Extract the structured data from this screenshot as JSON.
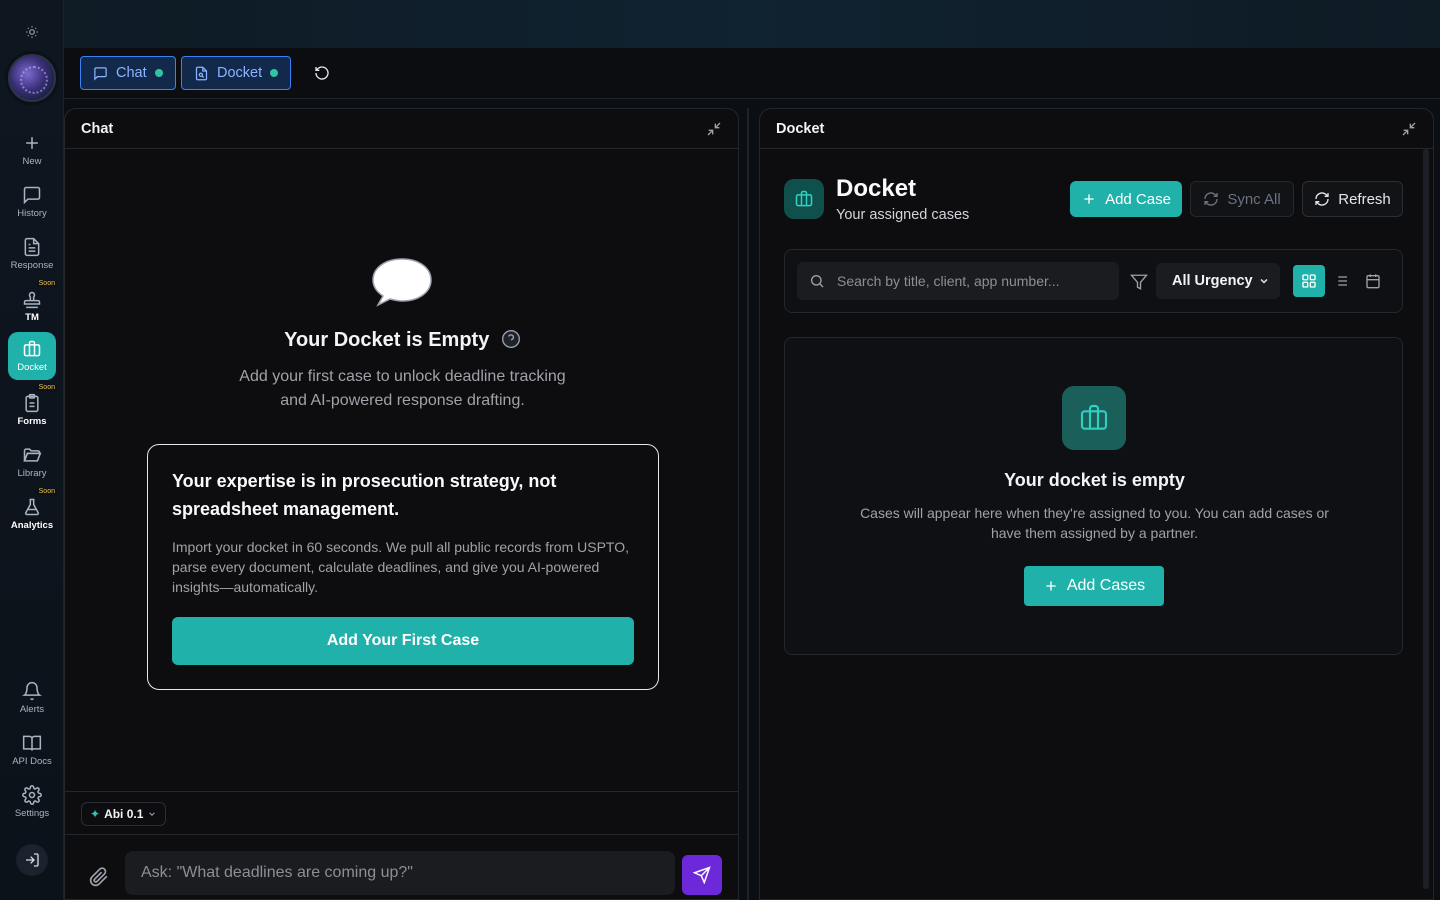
{
  "sidebar": {
    "items": [
      {
        "label": "New",
        "icon": "plus-icon"
      },
      {
        "label": "History",
        "icon": "message-square-icon"
      },
      {
        "label": "Response",
        "icon": "file-text-icon"
      },
      {
        "label": "TM",
        "icon": "stamp-icon",
        "badge": "Soon"
      },
      {
        "label": "Docket",
        "icon": "briefcase-icon"
      },
      {
        "label": "Forms",
        "icon": "clipboard-icon",
        "badge": "Soon"
      },
      {
        "label": "Library",
        "icon": "folder-open-icon"
      },
      {
        "label": "Analytics",
        "icon": "flask-icon",
        "badge": "Soon"
      },
      {
        "label": "Alerts",
        "icon": "bell-icon"
      },
      {
        "label": "API Docs",
        "icon": "book-open-icon"
      },
      {
        "label": "Settings",
        "icon": "gear-icon"
      }
    ],
    "active": "Docket"
  },
  "toolbar": {
    "tabs": [
      {
        "label": "Chat",
        "icon": "message-square-icon"
      },
      {
        "label": "Docket",
        "icon": "file-search-icon"
      }
    ]
  },
  "chat": {
    "header": "Chat",
    "empty_title": "Your Docket is Empty",
    "empty_sub_line1": "Add your first case to unlock deadline tracking",
    "empty_sub_line2": "and AI-powered response drafting.",
    "promo_title": "Your expertise is in prosecution strategy, not spreadsheet management.",
    "promo_body": "Import your docket in 60 seconds. We pull all public records from USPTO, parse every document, calculate deadlines, and give you AI-powered insights—automatically.",
    "promo_button": "Add Your First Case",
    "model": "Abi 0.1",
    "input_placeholder": "Ask: \"What deadlines are coming up?\""
  },
  "docket": {
    "header": "Docket",
    "title": "Docket",
    "subtitle": "Your assigned cases",
    "add_case": "Add Case",
    "sync_all": "Sync All",
    "refresh": "Refresh",
    "search_placeholder": "Search by title, client, app number...",
    "urgency_selected": "All Urgency",
    "view_mode": "grid",
    "empty_title": "Your docket is empty",
    "empty_sub": "Cases will appear here when they're assigned to you. You can add cases or have them assigned by a partner.",
    "empty_button": "Add Cases"
  },
  "colors": {
    "accent": "#20b2aa",
    "send": "#6d28d9",
    "tab_border": "#3b82f6"
  }
}
